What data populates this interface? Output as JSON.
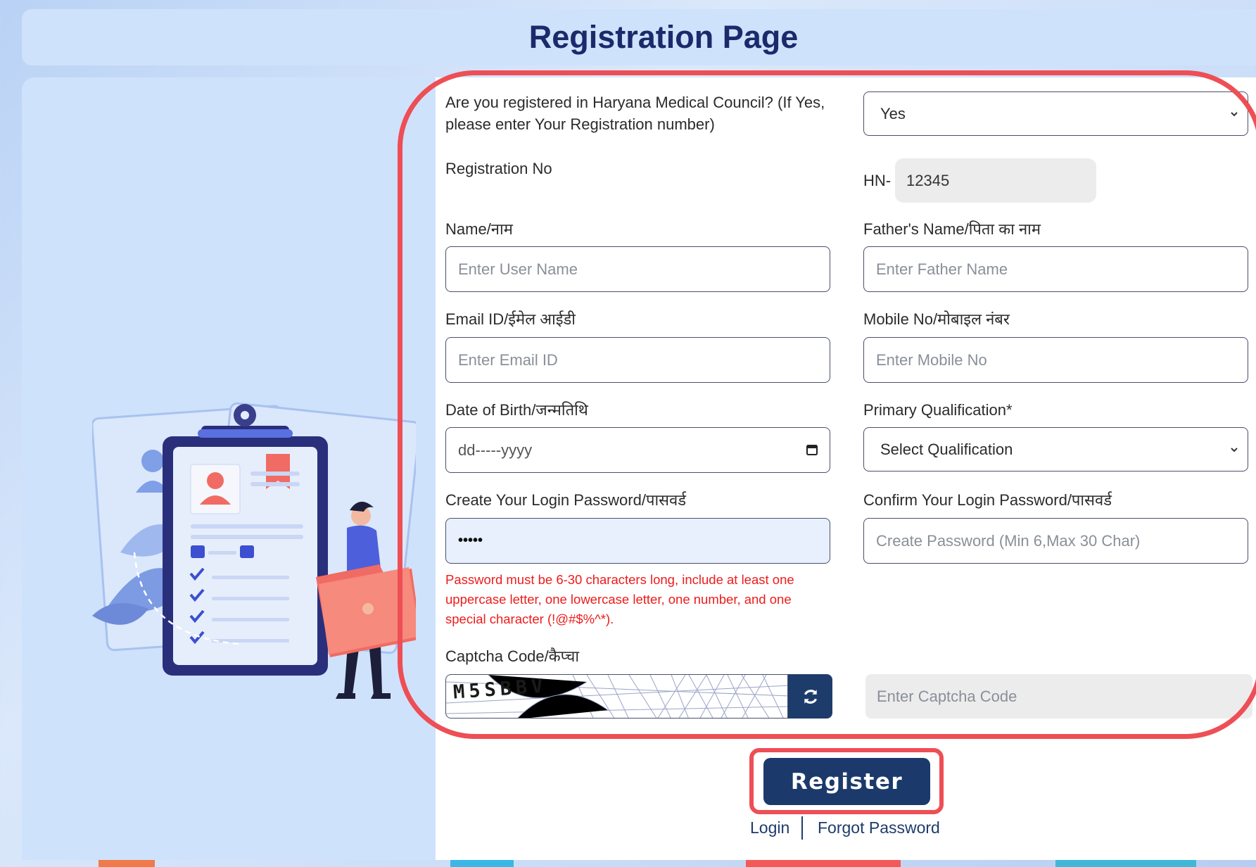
{
  "header": {
    "title": "Registration Page"
  },
  "form": {
    "hmc_question": {
      "label_line1": "Are you registered in Haryana Medical Council? (If Yes,",
      "label_line2": "please enter Your Registration number)",
      "value": "Yes"
    },
    "registration": {
      "label": "Registration No",
      "prefix": "HN-",
      "value": "12345"
    },
    "name": {
      "label": "Name/नाम",
      "placeholder": "Enter User Name"
    },
    "father_name": {
      "label": "Father's Name/पिता का नाम",
      "placeholder": "Enter Father Name"
    },
    "email": {
      "label": "Email ID/ईमेल आईडी",
      "placeholder": "Enter Email ID"
    },
    "mobile": {
      "label": "Mobile No/मोबाइल नंबर",
      "placeholder": "Enter Mobile No"
    },
    "dob": {
      "label": "Date of Birth/जन्मतिथि",
      "placeholder": "dd-----yyyy"
    },
    "qualification": {
      "label": "Primary Qualification*",
      "value": "Select Qualification"
    },
    "password": {
      "label": "Create Your Login Password/पासवर्ड",
      "value": "•••••"
    },
    "confirm_password": {
      "label": "Confirm Your Login Password/पासवर्ड",
      "placeholder": "Create Password (Min 6,Max 30 Char)"
    },
    "password_error": {
      "line1": "Password must be 6-30 characters long, include at least one",
      "line2": "uppercase letter, one lowercase letter, one number, and one",
      "line3": "special character (!@#$%^*)."
    },
    "captcha": {
      "label": "Captcha Code/कैप्चा",
      "image_text": "M5SBBV",
      "placeholder": "Enter Captcha Code"
    },
    "register_label": "Register",
    "links": {
      "login": "Login",
      "forgot": "Forgot Password"
    }
  },
  "colors": {
    "primary": "#1b3a6b",
    "title": "#1b2a6b",
    "error": "#ee1b1b",
    "highlight": "#ee4e55",
    "panel": "#cfe2fb"
  }
}
